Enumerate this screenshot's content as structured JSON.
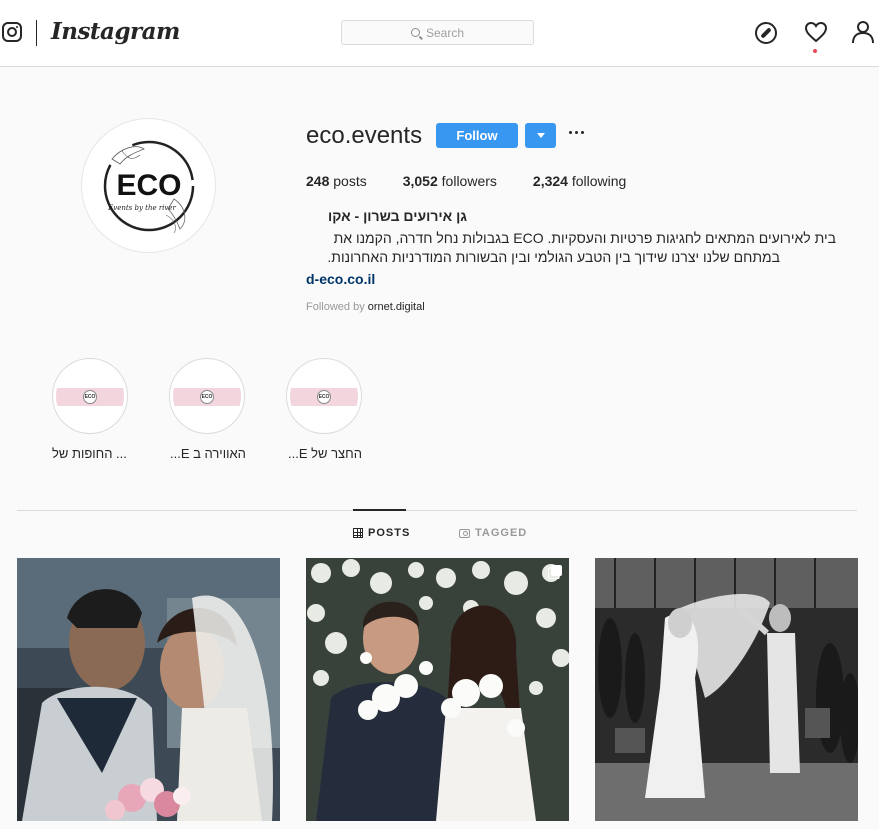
{
  "nav": {
    "brand": "Instagram",
    "search_placeholder": "Search"
  },
  "profile": {
    "username": "eco.events",
    "follow_label": "Follow",
    "stats": {
      "posts_count": "248",
      "posts_label": " posts",
      "followers_count": "3,052",
      "followers_label": " followers",
      "following_count": "2,324",
      "following_label": " following"
    },
    "full_name": "גן אירועים בשרון - אקו",
    "bio_line1": "בית לאירועים המתאים לחגיגות פרטיות והעסקיות. ECO בגבולות נחל חדרה, הקמנו את",
    "bio_line2": "במתחם שלנו יצרנו שידוך בין הטבע הגולמי ובין הבשורות המודרניות האחרונות.",
    "website": "d-eco.co.il",
    "followed_by_prefix": "Followed by ",
    "followed_by_user": "ornet.digital",
    "avatar_logo": {
      "title": "ECO",
      "subtitle": "Events by the river"
    }
  },
  "highlights": [
    {
      "label": "... החופות של",
      "logo": "ECO"
    },
    {
      "label": "האווירה ב E...",
      "logo": "ECO"
    },
    {
      "label": "החצר של E...",
      "logo": "ECO"
    }
  ],
  "tabs": {
    "posts": "POSTS",
    "tagged": "TAGGED"
  },
  "colors": {
    "accent": "#3897f0",
    "link": "#003569",
    "notification": "#ed4956"
  }
}
